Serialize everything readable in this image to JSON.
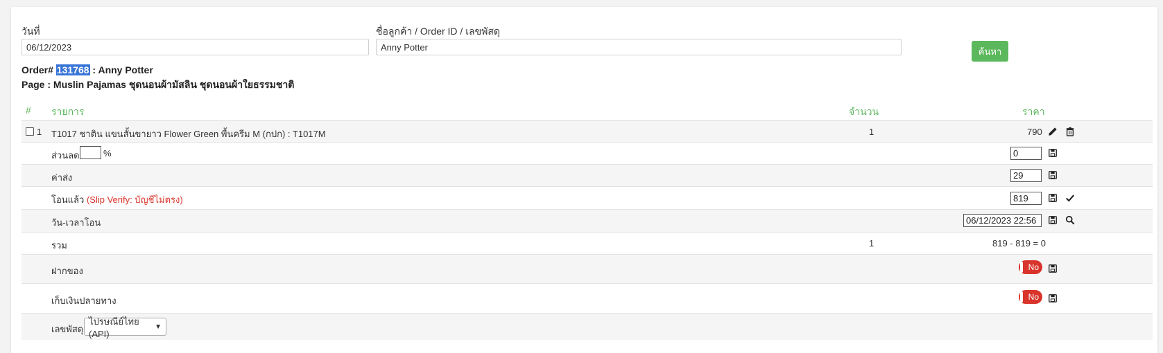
{
  "filters": {
    "date_label": "วันที่",
    "date_value": "06/12/2023",
    "customer_label": "ชื่อลูกค้า / Order ID / เลขพัสดุ",
    "customer_value": "Anny Potter",
    "search_button": "ค้นหา"
  },
  "order": {
    "prefix": "Order#",
    "id": "131768",
    "customer": ": Anny Potter",
    "page_line": "Page : Muslin Pajamas ชุดนอนผ้ามัสลิน ชุดนอนผ้าใยธรรมชาติ"
  },
  "table": {
    "headers": {
      "index": "#",
      "item": "รายการ",
      "qty": "จำนวน",
      "price": "ราคา"
    },
    "item": {
      "index": "1",
      "name": "T1017 ชาติน แขนสั้นขายาว Flower Green พื้นครีม M (กปก) : T1017M",
      "qty": "1",
      "price": "790"
    },
    "discount": {
      "label": "ส่วนลด",
      "unit": "%",
      "value": "0"
    },
    "shipping": {
      "label": "ค่าส่ง",
      "value": "29"
    },
    "transferred": {
      "label": "โอนแล้ว",
      "note": "(Slip Verify: บัญชีไม่ตรง)",
      "value": "819"
    },
    "transfer_time": {
      "label": "วัน-เวลาโอน",
      "value": "06/12/2023 22:56"
    },
    "total": {
      "label": "รวม",
      "qty": "1",
      "value": "819 - 819 = 0"
    },
    "deposit": {
      "label": "ฝากของ",
      "toggle": "No"
    },
    "cod": {
      "label": "เก็บเงินปลายทาง",
      "toggle": "No"
    },
    "tracking": {
      "label": "เลขพัสดุ",
      "selected": "ไปรษณีย์ไทย (API)"
    }
  }
}
